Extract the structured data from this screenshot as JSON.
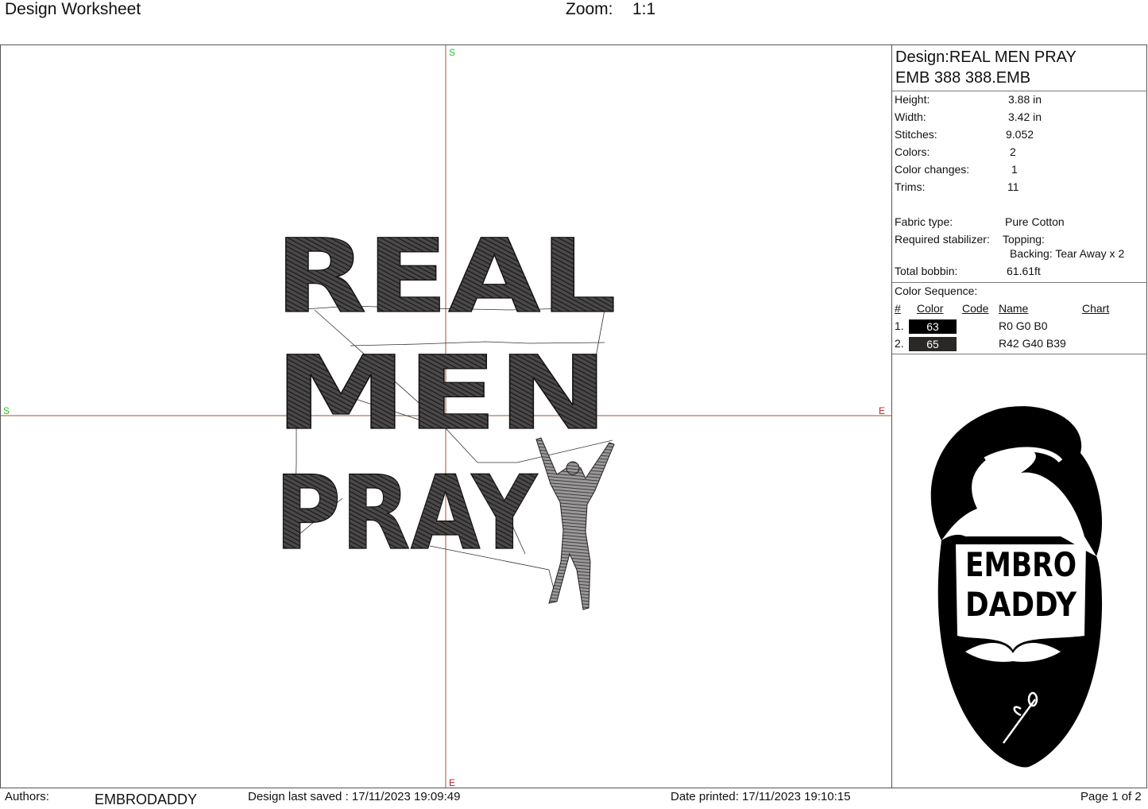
{
  "header": {
    "title": "Design Worksheet",
    "zoom_label": "Zoom:",
    "zoom_value": "1:1"
  },
  "canvas": {
    "marker_start": "S",
    "marker_end": "E",
    "design_lines": [
      "REAL",
      "MEN",
      "PRAY"
    ],
    "thread_color": "#2a2827"
  },
  "info": {
    "design": "Design:REAL MEN PRAY",
    "file": "EMB 388 388.EMB",
    "specs": [
      {
        "k": "Height:",
        "v": "3.88 in"
      },
      {
        "k": "Width:",
        "v": "3.42 in"
      },
      {
        "k": "Stitches:",
        "v": "9.052"
      },
      {
        "k": "Colors:",
        "v": "2"
      },
      {
        "k": "Color changes:",
        "v": "1"
      },
      {
        "k": "Trims:",
        "v": "11"
      }
    ],
    "fabric_label": "Fabric type:",
    "fabric_value": "Pure Cotton",
    "stabilizer_label": "Required stabilizer:",
    "topping": "Topping:",
    "backing": "Backing: Tear Away x 2",
    "bobbin_label": "Total bobbin:",
    "bobbin_value": "61.61ft",
    "sequence_title": "Color Sequence:",
    "sequence_headers": {
      "num": "#",
      "color": "Color",
      "code": "Code",
      "name": "Name",
      "chart": "Chart"
    },
    "sequence": [
      {
        "num": "1.",
        "color": "63",
        "hex": "#000000",
        "name": "R0 G0 B0"
      },
      {
        "num": "2.",
        "color": "65",
        "hex": "#2a2827",
        "name": "R42 G40 B39"
      }
    ]
  },
  "logo": {
    "line1": "EMBRO",
    "line2": "DADDY"
  },
  "footer": {
    "authors_label": "Authors:",
    "authors_value": "EMBRODADDY",
    "saved": "Design last saved : 17/11/2023 19:09:49",
    "printed": "Date printed: 17/11/2023 19:10:15",
    "page": "Page 1 of 2"
  }
}
